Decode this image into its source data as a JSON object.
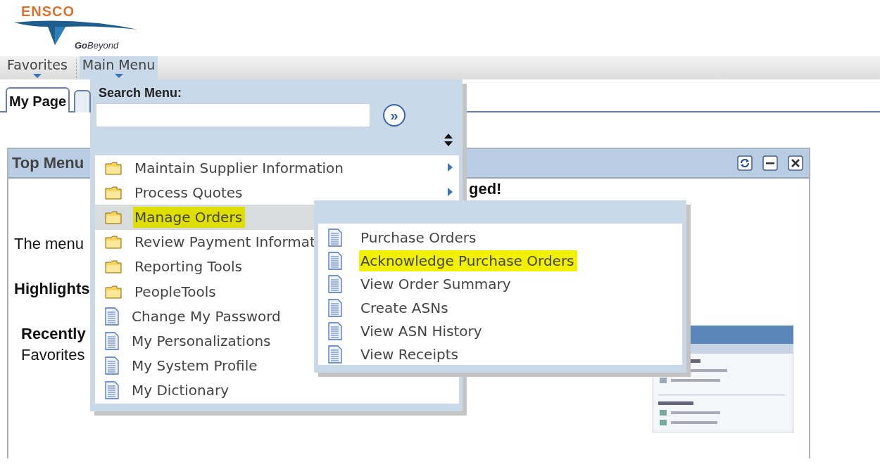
{
  "logo": {
    "name": "ENSCO",
    "tagline": "**Go**Beyond"
  },
  "menu_bar": [
    {
      "label": "Favorites",
      "selected": false
    },
    {
      "label": "Main Menu",
      "selected": true
    }
  ],
  "tabs": [
    {
      "label": "My Page",
      "selected": true
    },
    {
      "selected": false
    }
  ],
  "panel": {
    "title": "Top Menu",
    "heading_fragment": "ged!",
    "text": "The menu",
    "highlights": "Highlights",
    "recently": "Recently",
    "favorites": "Favorites"
  },
  "main_menu": {
    "search_label": "Search Menu:",
    "go_button": "»",
    "items": [
      {
        "label": "Maintain Supplier Information",
        "kind": "folder",
        "arrow": true,
        "selected": false,
        "highlighted": false
      },
      {
        "label": "Process Quotes",
        "kind": "folder",
        "arrow": true,
        "selected": false,
        "highlighted": false
      },
      {
        "label": "Manage Orders",
        "kind": "folder",
        "selected": true,
        "highlighted": true
      },
      {
        "label": "Review Payment Informat",
        "kind": "folder",
        "selected": false,
        "highlighted": false
      },
      {
        "label": "Reporting Tools",
        "kind": "folder",
        "selected": false,
        "highlighted": false
      },
      {
        "label": "PeopleTools",
        "kind": "folder",
        "selected": false,
        "highlighted": false
      },
      {
        "label": "Change My Password",
        "kind": "page",
        "selected": false,
        "highlighted": false
      },
      {
        "label": "My Personalizations",
        "kind": "page",
        "selected": false,
        "highlighted": false
      },
      {
        "label": "My System Profile",
        "kind": "page",
        "selected": false,
        "highlighted": false
      },
      {
        "label": "My Dictionary",
        "kind": "page",
        "arrow": false,
        "selected": false,
        "highlighted": false
      }
    ]
  },
  "submenu": {
    "items": [
      {
        "label": "Purchase Orders",
        "kind": "page",
        "highlighted": false
      },
      {
        "label": "Acknowledge Purchase Orders",
        "kind": "page",
        "highlighted": true
      },
      {
        "label": "View Order Summary",
        "kind": "page",
        "highlighted": false
      },
      {
        "label": "Create ASNs",
        "kind": "page",
        "highlighted": false
      },
      {
        "label": "View ASN History",
        "kind": "page",
        "highlighted": false
      },
      {
        "label": "View Receipts",
        "kind": "page",
        "highlighted": false
      }
    ]
  }
}
